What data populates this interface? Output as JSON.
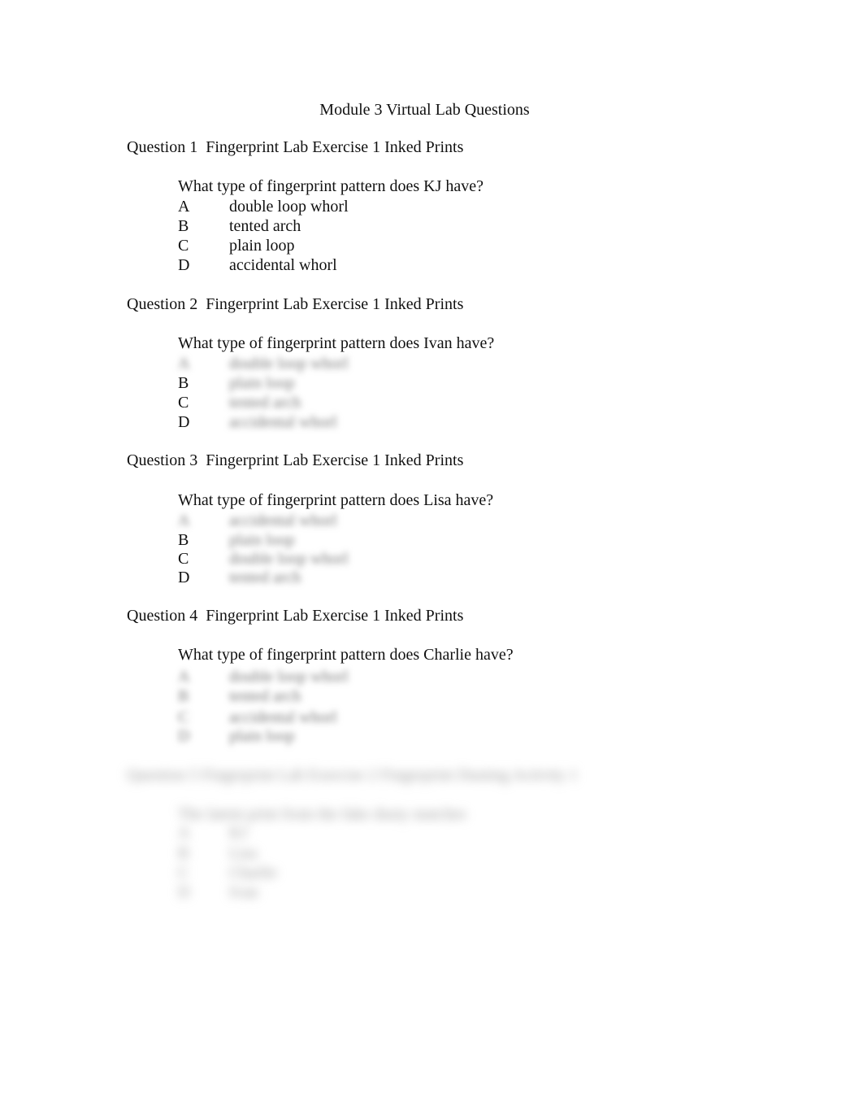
{
  "document": {
    "title": "Module 3 Virtual Lab Questions",
    "questions": [
      {
        "header": "Question 1  Fingerprint Lab Exercise 1 Inked Prints",
        "prompt": "What type of fingerprint pattern does KJ have?",
        "options": [
          {
            "letter": "A",
            "text": "double loop whorl"
          },
          {
            "letter": "B",
            "text": "tented arch"
          },
          {
            "letter": "C",
            "text": "plain loop"
          },
          {
            "letter": "D",
            "text": "accidental whorl"
          }
        ]
      },
      {
        "header": "Question 2  Fingerprint Lab Exercise 1 Inked Prints",
        "prompt": "What type of fingerprint pattern does Ivan have?",
        "options": [
          {
            "letter": "A",
            "text": "double loop whorl"
          },
          {
            "letter": "B",
            "text": "plain loop"
          },
          {
            "letter": "C",
            "text": "tented arch"
          },
          {
            "letter": "D",
            "text": "accidental whorl"
          }
        ]
      },
      {
        "header": "Question 3  Fingerprint Lab Exercise 1 Inked Prints",
        "prompt": "What type of fingerprint pattern does Lisa have?",
        "options": [
          {
            "letter": "A",
            "text": "accidental whorl"
          },
          {
            "letter": "B",
            "text": "plain loop"
          },
          {
            "letter": "C",
            "text": "double loop whorl"
          },
          {
            "letter": "D",
            "text": "tented arch"
          }
        ]
      },
      {
        "header": "Question 4  Fingerprint Lab Exercise 1 Inked Prints",
        "prompt": "What type of fingerprint pattern does Charlie have?",
        "options": [
          {
            "letter": "A",
            "text": "double loop whorl"
          },
          {
            "letter": "B",
            "text": "tented arch"
          },
          {
            "letter": "C",
            "text": "accidental whorl"
          },
          {
            "letter": "D",
            "text": "plain loop"
          }
        ]
      },
      {
        "header": "Question 5 Fingerprint Lab Exercise 2 Fingerprint Dusting Activity 1",
        "prompt": "The latent print from the fake dusty matches",
        "options": [
          {
            "letter": "A",
            "text": "KJ"
          },
          {
            "letter": "B",
            "text": "Lisa"
          },
          {
            "letter": "C",
            "text": "Charlie"
          },
          {
            "letter": "D",
            "text": "Ivan"
          }
        ]
      }
    ]
  }
}
